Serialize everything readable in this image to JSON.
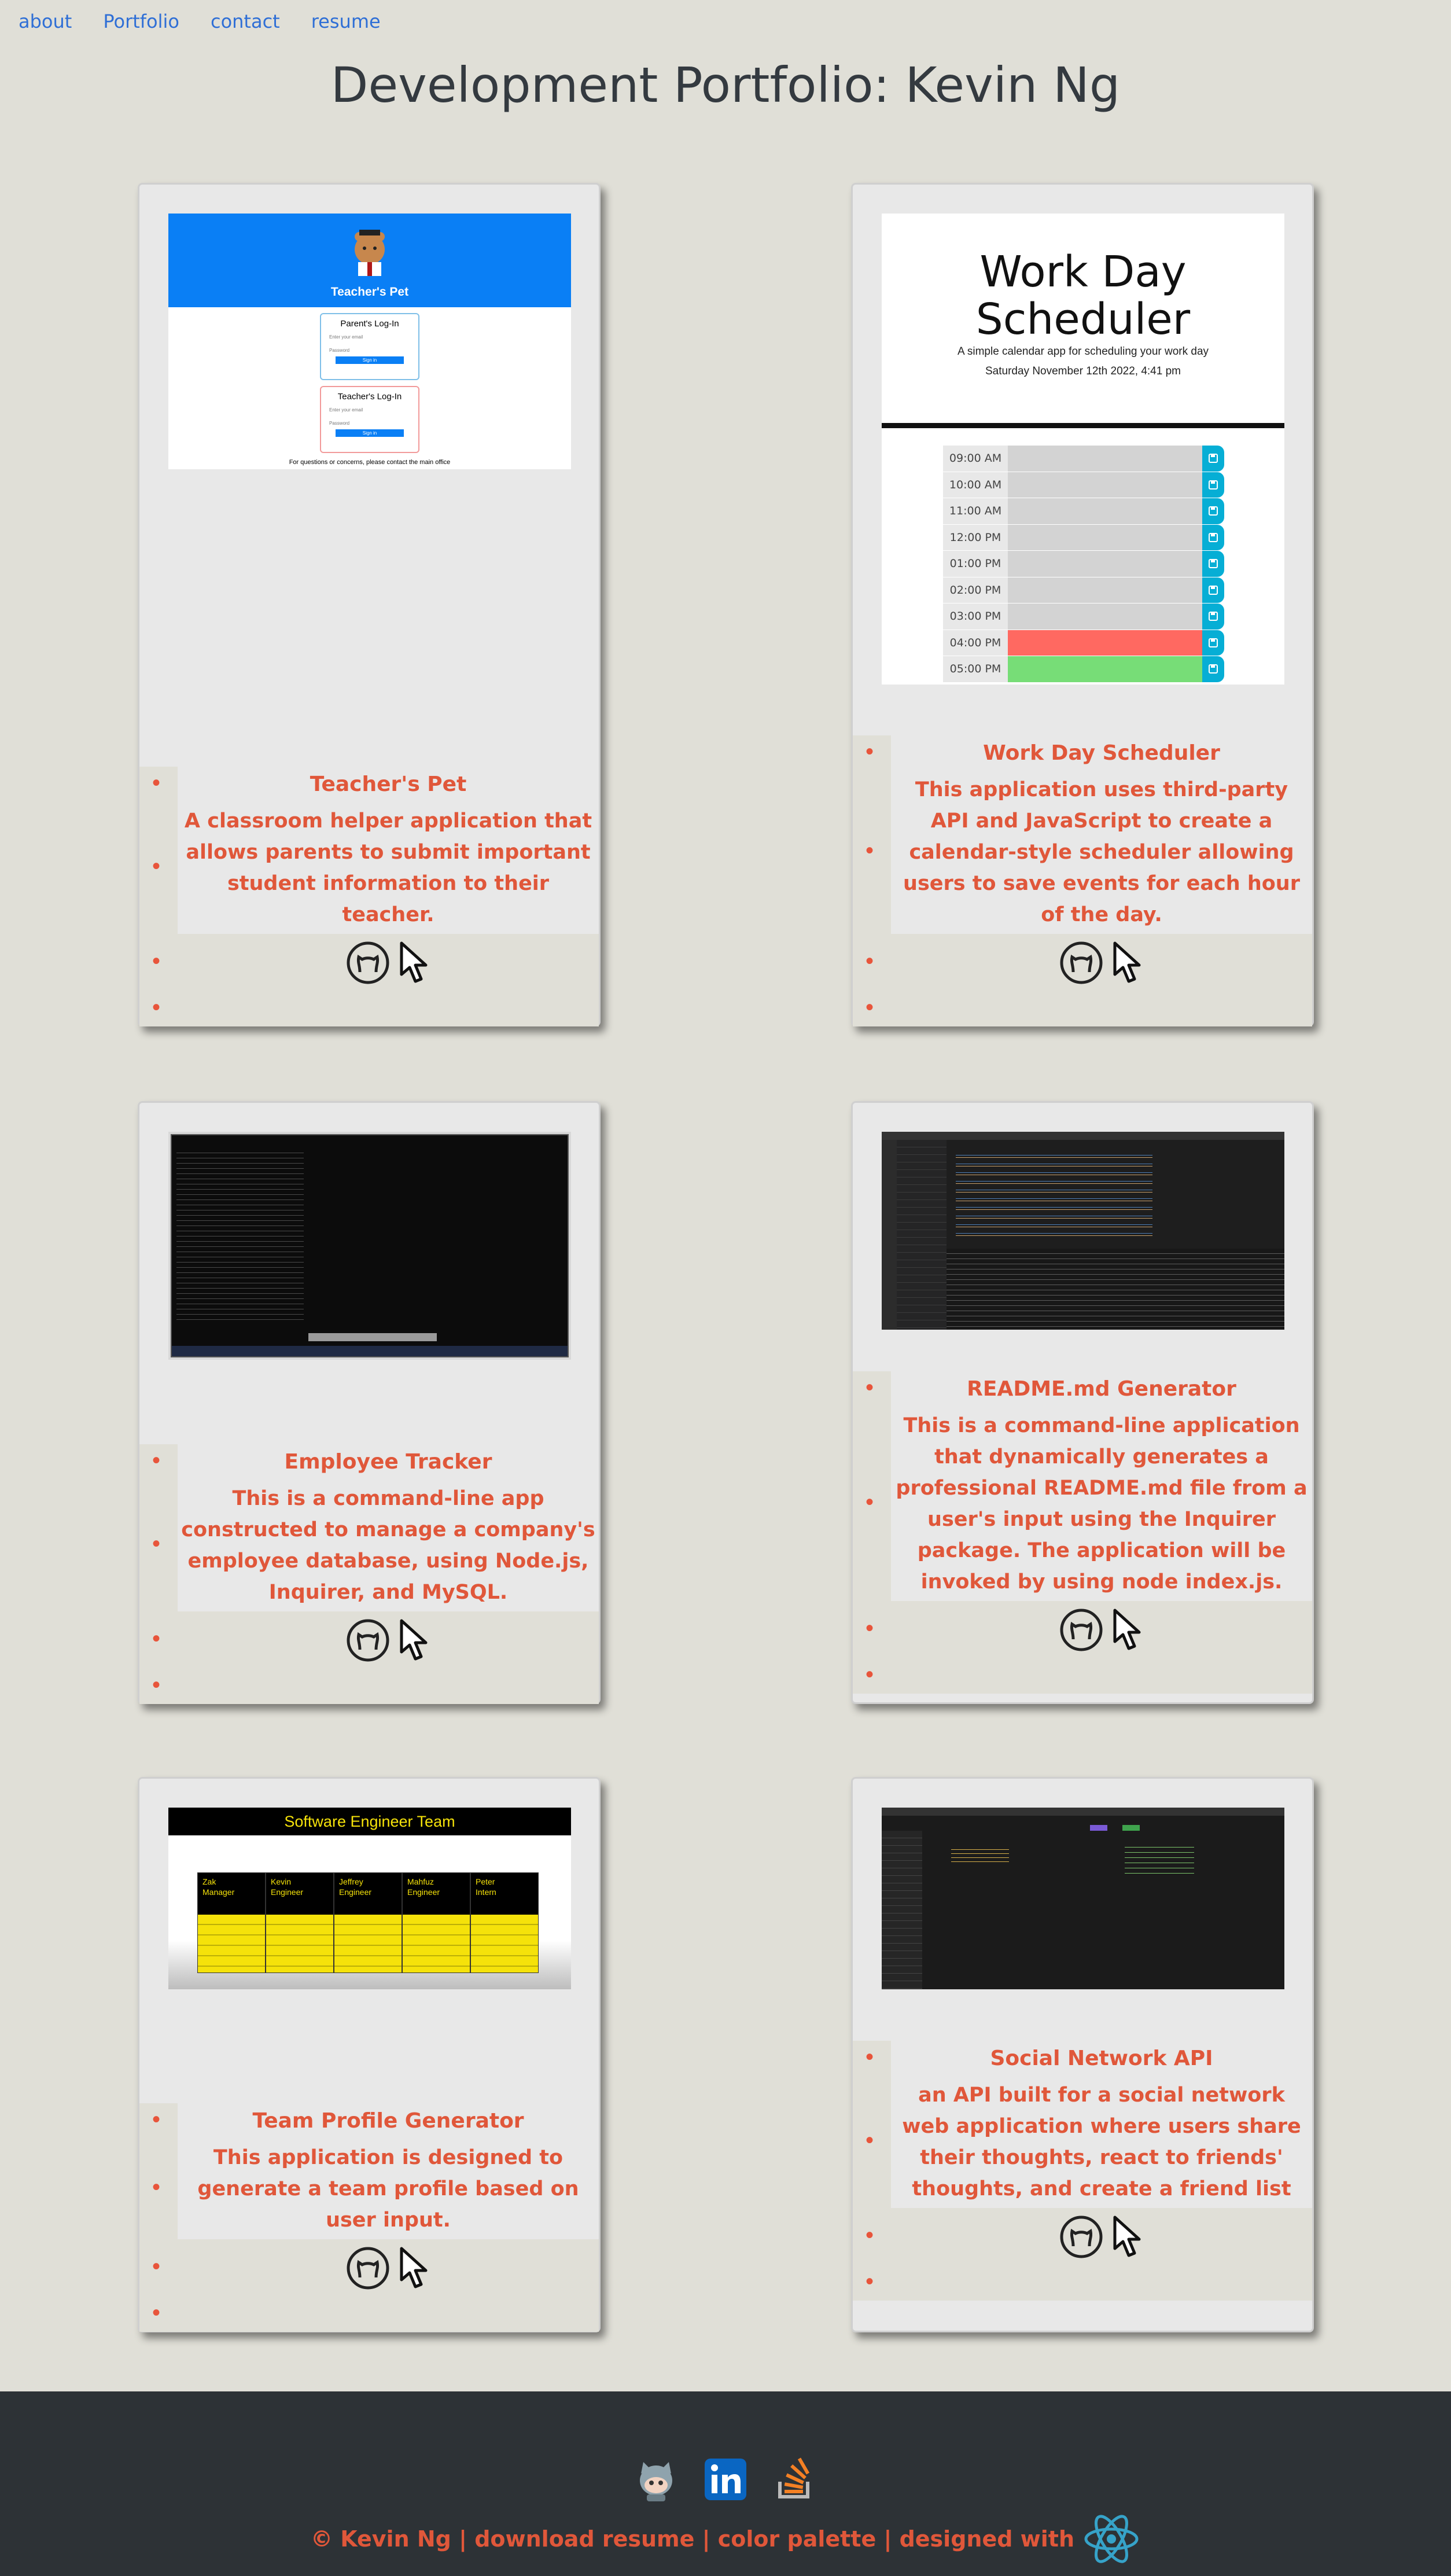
{
  "nav": {
    "items": [
      "about",
      "Portfolio",
      "contact",
      "resume"
    ]
  },
  "page_title": "Development Portfolio: Kevin Ng",
  "projects": [
    {
      "title": "Teacher's Pet",
      "description": "A classroom helper application that allows parents to submit important student information to their teacher."
    },
    {
      "title": "Work Day Scheduler",
      "description": "This application uses third-party API and JavaScript to create a calendar-style scheduler allowing users to save events for each hour of the day."
    },
    {
      "title": "Employee Tracker",
      "description": "This is a command-line app constructed to manage a company's employee database, using Node.js, Inquirer, and MySQL."
    },
    {
      "title": "README.md Generator",
      "description": "This is a command-line application that dynamically generates a professional README.md file from a user's input using the Inquirer package. The application will be invoked by using node index.js."
    },
    {
      "title": "Team Profile Generator",
      "description": "This application is designed to generate a team profile based on user input."
    },
    {
      "title": "Social Network API",
      "description": "an API built for a social network web application where users share their thoughts, react to friends' thoughts, and create a friend list"
    }
  ],
  "teachers_pet_shot": {
    "brand": "Teacher's Pet",
    "parent_heading": "Parent's Log-In",
    "teacher_heading": "Teacher's Log-In",
    "email_label": "Enter your email",
    "password_label": "Password",
    "sign_in": "Sign in",
    "footer_note": "For questions or concerns, please contact the main office"
  },
  "scheduler_shot": {
    "title": "Work Day Scheduler",
    "subtitle": "A simple calendar app for scheduling your work day",
    "date": "Saturday November 12th 2022, 4:41 pm",
    "hours": [
      "09:00 AM",
      "10:00 AM",
      "11:00 AM",
      "12:00 PM",
      "01:00 PM",
      "02:00 PM",
      "03:00 PM",
      "04:00 PM",
      "05:00 PM"
    ]
  },
  "team_shot": {
    "title": "Software Engineer Team",
    "members": [
      {
        "name": "Zak",
        "role": "Manager"
      },
      {
        "name": "Kevin",
        "role": "Engineer"
      },
      {
        "name": "Jeffrey",
        "role": "Engineer"
      },
      {
        "name": "Mahfuz",
        "role": "Engineer"
      },
      {
        "name": "Peter",
        "role": "Intern"
      }
    ]
  },
  "footer": {
    "text": "© Kevin Ng | download resume | color palette | designed with"
  },
  "colors": {
    "accent": "#e0573a",
    "background": "#e0dfd7",
    "footer": "#2d3236",
    "link": "#2f6fd6"
  }
}
